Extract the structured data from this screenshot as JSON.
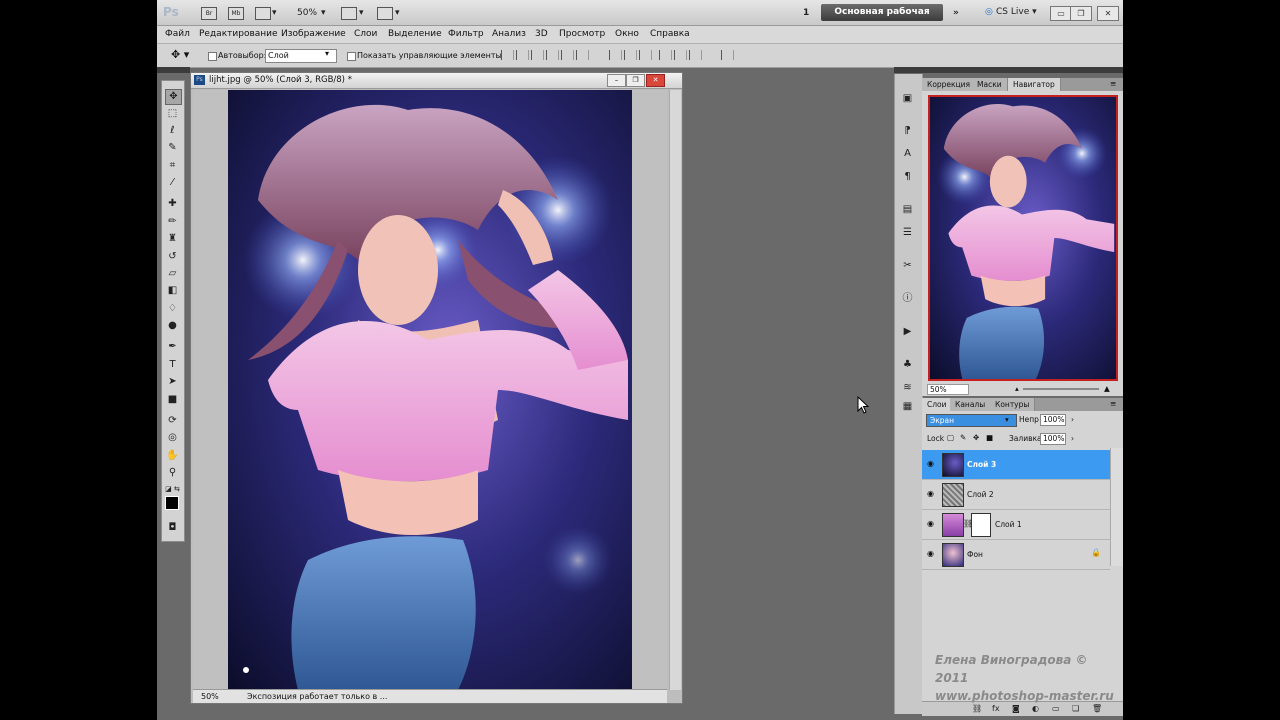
{
  "titlebar": {
    "app_logo": "Ps",
    "zoom": "50%",
    "workspace_number": "1",
    "workspace_button": "Основная рабочая среда",
    "overflow": "»",
    "cs_live": "CS Live ▾",
    "minimize": "▭",
    "restore": "❐",
    "close": "✕",
    "icons": [
      "Br",
      "Mb",
      "view",
      "grid",
      "screen"
    ]
  },
  "menu": [
    "Файл",
    "Редактирование",
    "Изображение",
    "Слои",
    "Выделение",
    "Фильтр",
    "Анализ",
    "3D",
    "Просмотр",
    "Окно",
    "Справка"
  ],
  "options": {
    "auto_select_label": "Автовыбор:",
    "auto_select_value": "Слой",
    "show_controls_label": "Показать управляющие элементы"
  },
  "document": {
    "title": "lijht.jpg @ 50% (Слой 3, RGB/8) *",
    "status_zoom": "50%",
    "status_message": "Экспозиция работает только в ...",
    "controls": [
      "–",
      "❐",
      "✕"
    ]
  },
  "tools": [
    "move-tool",
    "marquee-tool",
    "lasso-tool",
    "quick-select-tool",
    "crop-tool",
    "eyedropper-tool",
    "healing-brush-tool",
    "brush-tool",
    "clone-stamp-tool",
    "history-brush-tool",
    "eraser-tool",
    "gradient-tool",
    "blur-tool",
    "dodge-tool",
    "pen-tool",
    "type-tool",
    "path-select-tool",
    "shape-tool",
    "3d-rotate-tool",
    "3d-orbit-tool",
    "hand-tool",
    "zoom-tool"
  ],
  "navigator": {
    "tabs": [
      "Коррекция",
      "Маски",
      "Навигатор"
    ],
    "active_tab": "Навигатор",
    "zoom": "50%"
  },
  "layers_panel": {
    "tabs": [
      "Слои",
      "Каналы",
      "Контуры"
    ],
    "active_tab": "Слои",
    "blend_mode": "Экран",
    "opacity_label": "Непр",
    "opacity": "100%",
    "lock_label": "Lock",
    "fill_label": "Заливка",
    "fill": "100%",
    "layers": [
      {
        "name": "Слой 3",
        "selected": true
      },
      {
        "name": "Слой 2",
        "selected": false
      },
      {
        "name": "Слой 1",
        "selected": false
      },
      {
        "name": "Фон",
        "selected": false
      }
    ]
  },
  "watermark": {
    "line1": "Елена Виноградова © 2011",
    "line2": "www.photoshop-master.ru"
  },
  "colors": {
    "accent": "#3c9bf0",
    "close_red": "#d9463a",
    "workspace_bg": "#6a6a6a"
  }
}
